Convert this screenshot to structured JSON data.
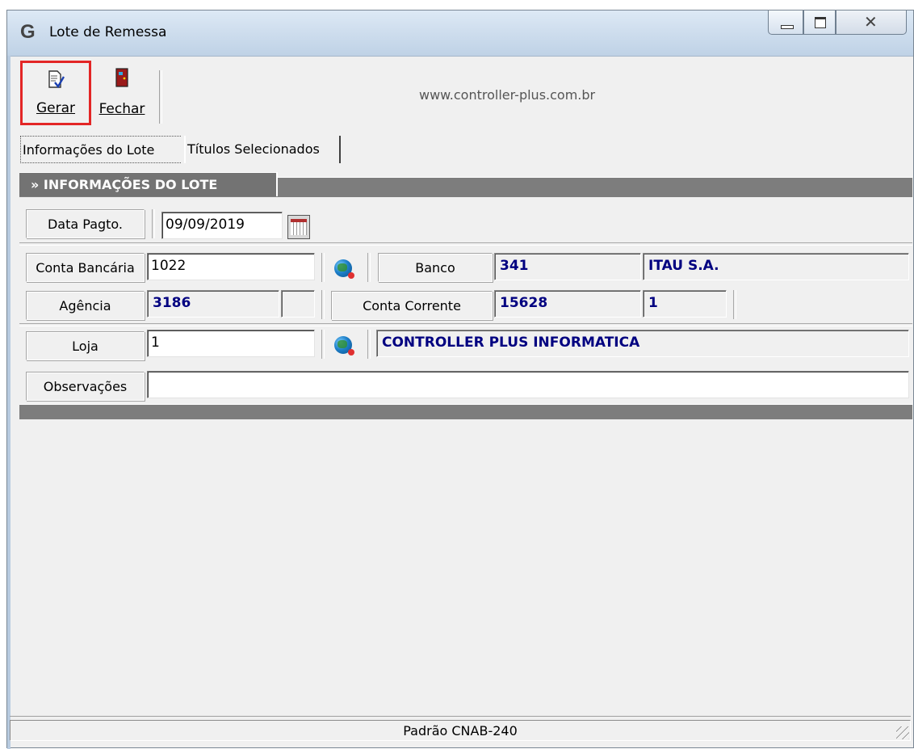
{
  "window": {
    "title": "Lote de Remessa",
    "logo_glyph": "G"
  },
  "toolbar": {
    "gerar_label": "Gerar",
    "fechar_label": "Fechar",
    "website": "www.controller-plus.com.br"
  },
  "tabs": [
    {
      "label": "Informações do Lote",
      "active": true
    },
    {
      "label": "Títulos Selecionados",
      "active": false
    }
  ],
  "section": {
    "title": "» INFORMAÇÕES DO LOTE"
  },
  "form": {
    "data_pagto": {
      "label": "Data Pagto.",
      "value": "09/09/2019"
    },
    "conta_bancaria": {
      "label": "Conta Bancária",
      "value": "1022"
    },
    "banco": {
      "label": "Banco",
      "code": "341",
      "name": "ITAU S.A."
    },
    "agencia": {
      "label": "Agência",
      "value": "3186",
      "digit": ""
    },
    "conta_corrente": {
      "label": "Conta Corrente",
      "value": "15628",
      "digit": "1"
    },
    "loja": {
      "label": "Loja",
      "value": "1",
      "name": "CONTROLLER PLUS INFORMATICA"
    },
    "observacoes": {
      "label": "Observações",
      "value": ""
    }
  },
  "status": {
    "text": "Padrão CNAB-240"
  },
  "colors": {
    "highlight_box": "#e32626",
    "readonly_text": "#000080",
    "section_bar": "#7d7d7d"
  },
  "icons": {
    "gerar": "generate-doc-icon",
    "fechar": "exit-door-icon",
    "lookup": "globe-search-icon",
    "calendar": "calendar-icon"
  }
}
